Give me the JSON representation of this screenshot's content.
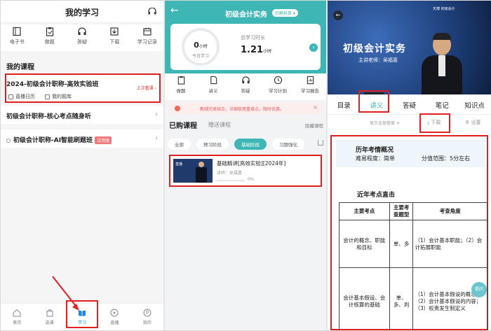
{
  "panel1": {
    "title": "我的学习",
    "icons": [
      {
        "label": "电子书",
        "icon": "book-icon"
      },
      {
        "label": "做题",
        "icon": "clipboard-icon"
      },
      {
        "label": "答疑",
        "icon": "headset-icon"
      },
      {
        "label": "下载",
        "icon": "download-icon"
      },
      {
        "label": "学习记录",
        "icon": "calendar-icon"
      }
    ],
    "section_title": "我的课程",
    "course": {
      "title": "2024-初级会计职称-高效实验班",
      "last_watch": "上次看课",
      "link1": "直播日历",
      "link2": "我的题库"
    },
    "row2": "初级会计职称-核心考点随身听",
    "row3": "初级会计职称-AI智能刷题班",
    "row3_badge": "试用版",
    "nav": [
      {
        "label": "首页"
      },
      {
        "label": "选课"
      },
      {
        "label": "学习"
      },
      {
        "label": "直播"
      },
      {
        "label": "我的"
      }
    ],
    "active_nav": "学习"
  },
  "panel2": {
    "title": "初级会计实务",
    "switch": "切换科目",
    "today_value": "0",
    "today_unit": "小时",
    "today_label": "今日学习",
    "total_label": "总学习时长",
    "total_value": "1.21",
    "total_unit": "小时",
    "icons": [
      {
        "label": "做题",
        "icon": "clipboard-icon"
      },
      {
        "label": "讲义",
        "icon": "document-icon"
      },
      {
        "label": "答疑",
        "icon": "headset-icon"
      },
      {
        "label": "学习计划",
        "icon": "clock-icon"
      },
      {
        "label": "学习报告",
        "icon": "report-icon"
      }
    ],
    "notice": "教辅完美结合，详细梳理重难点，限时优惠。",
    "tab_bought": "已购课程",
    "tab_gift": "赠送课程",
    "hide_course": "隐藏课程",
    "chips": [
      "全部",
      "预习阶段",
      "基础阶段",
      "习题强化"
    ],
    "active_chip": "基础阶段",
    "lesson": {
      "thumb_text": "直播",
      "title": "基础精讲[高效实验][2024年]",
      "teacher": "讲师：吴福喜",
      "progress": 0,
      "progress_text": "0%"
    }
  },
  "panel3": {
    "video_logo": "天博 初级会计",
    "video_title": "初级会计实务",
    "video_teacher": "主讲老师：吴福喜",
    "tabs": [
      "目录",
      "讲义",
      "答疑",
      "笔记",
      "知识点"
    ],
    "active_tab": "讲义",
    "show_all": "显示全部答案",
    "download": "下载",
    "settings": "设置",
    "doc_title": "历年考情概况",
    "difficulty": "难易程度：简单",
    "score_range": "分值范围：5分左右",
    "section": "近年考点直击",
    "table": {
      "headers": [
        "主要考点",
        "主要考查题型",
        "考查角度"
      ],
      "rows": [
        {
          "point": "会计的概念、职能和目标",
          "type": "单、多",
          "angle": "（1）会计基本职能；（2）会计拓展职能"
        },
        {
          "point": "会计基本假设、会计核算的基础",
          "type": "单、多、判",
          "angle": "（1）会计基本假设的概念；（2）会计基本假设的内容；（3）权责发生制定义"
        }
      ]
    },
    "float_btn": "提问"
  },
  "colors": {
    "accent": "#3fb6b6",
    "highlight": "#e02020",
    "brand_blue": "#1e8ad6"
  }
}
